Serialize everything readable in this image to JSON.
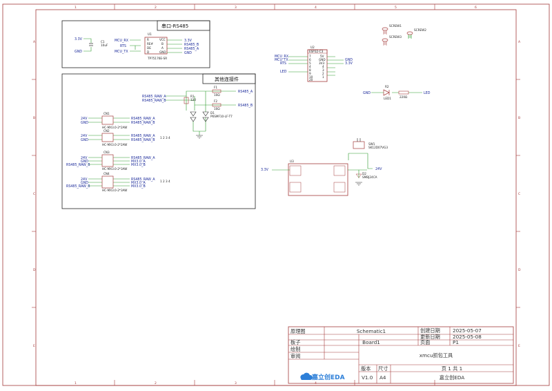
{
  "frame": {
    "col_labels": [
      "1",
      "2",
      "3",
      "4",
      "5",
      "6"
    ],
    "row_labels": [
      "A",
      "B",
      "C",
      "D",
      "E"
    ],
    "border_color": "#a43a3a",
    "wire_color": "#2a9a2a",
    "net_color": "#1b2a9a"
  },
  "rs485_block": {
    "title": "串口-RS485",
    "left_nets": [
      "3.3V",
      "GND"
    ],
    "cap_ref": "C1",
    "cap_val": "10uF",
    "mcu_nets": [
      "MCU_RX",
      "RTS",
      "MCU_TX"
    ],
    "ic_ref": "U1",
    "ic_pins_left": [
      "R",
      "RE#",
      "DE",
      "D"
    ],
    "ic_pins_right": [
      "VCC",
      "B",
      "A",
      "GND"
    ],
    "right_nets": [
      "3.3V",
      "RS485_B",
      "RS485_A",
      "GND"
    ],
    "ic_part": "TP75176E-SR"
  },
  "connector_block": {
    "title": "其他连接件",
    "raw_nets": [
      "RS485_RAW_A",
      "RS485_RAW_B"
    ],
    "out_nets": [
      "RS485_A",
      "RS485_B"
    ],
    "res_ref": "R1",
    "res_val": "120",
    "f1": "F1",
    "f2": "F2",
    "fuse_val": "10Ω",
    "tvs_ref": "D1",
    "tvs_part": "P6SMF10-LF-T7",
    "connectors": [
      {
        "ref": "CN1",
        "left": [
          "24V",
          "GND"
        ],
        "right": [
          "RS485_RAW_A",
          "RS485_RAW_B"
        ],
        "part": "HC-MX3.0-2*2AW",
        "note": ""
      },
      {
        "ref": "CN2",
        "left": [
          "24V",
          "GND"
        ],
        "right": [
          "RS485_RAW_A",
          "RS485_RAW_B"
        ],
        "part": "HC-MX3.0-2*2AW",
        "note": "1 2\n3 4"
      },
      {
        "ref": "CN3",
        "left": [
          "24V",
          "GND",
          "RS485_RAW_B"
        ],
        "right": [
          "RS485_RAW_A",
          "MX3.0_A",
          "MX3.0_B"
        ],
        "part": "HC-MX3.0-2*3AW",
        "note": ""
      },
      {
        "ref": "CN4",
        "left": [
          "24V",
          "GND",
          "RS485_RAW_B"
        ],
        "right": [
          "RS485_RAW_A",
          "MX3.0_A",
          "MX3.0_B"
        ],
        "part": "HC-MX3.0-2*3AW",
        "note": "1 2\n3 4"
      }
    ]
  },
  "screws": [
    "SCREW1",
    "SCREW2",
    "SCREW3",
    "SCREW4"
  ],
  "esp": {
    "ref": "U2",
    "part": "ESP32-C3",
    "left_nets": [
      "MCU_RX",
      "MCU_TX",
      "RTS",
      "LED"
    ],
    "right_nets": [
      "GND",
      "3.3V"
    ],
    "pins_left": [
      "7",
      "6",
      "5",
      "4",
      "8",
      "9",
      "10",
      "20",
      "21"
    ],
    "pins_right": [
      "5V",
      "GND",
      "3V3",
      "4",
      "3",
      "2",
      "1",
      "0"
    ]
  },
  "led": {
    "ref": "LED1",
    "res_ref": "R2",
    "res_val": "220Ω",
    "net_left": "GND",
    "net_right": "LED"
  },
  "power": {
    "sw_ref": "SW1",
    "sw_part": "SK12D07VG3",
    "ic_ref": "U3",
    "in_net": "24V",
    "out_net": "3.3V",
    "diode_ref": "D2",
    "diode_part": "SMBJ24CA",
    "gnd_label": "GND"
  },
  "title_block": {
    "row1": {
      "label": "原理图",
      "value": "Schematic1",
      "k1": "创建日期",
      "v1": "2025-05-07"
    },
    "row2": {
      "label": "更新日期",
      "value": "2025-05-08"
    },
    "row3": {
      "label": "板子",
      "value": "Board1",
      "k1": "页面",
      "v1": "P1"
    },
    "label_draw": "绘制",
    "label_review": "审阅",
    "project": "xmcu抓包工具",
    "ver_label": "版本",
    "size_label": "尺寸",
    "page_text": "页   1   共   1",
    "version": "V1.0",
    "size": "A4",
    "company": "嘉立创EDA",
    "logo_text": "嘉立创EDA"
  }
}
